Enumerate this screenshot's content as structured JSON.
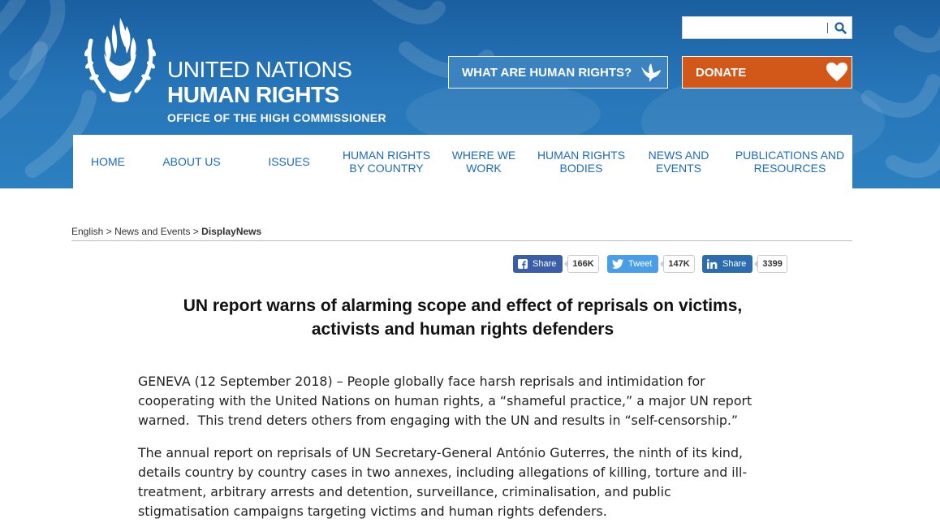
{
  "header": {
    "logo_line1": "UNITED NATIONS",
    "logo_line2": "HUMAN RIGHTS",
    "logo_line3": "OFFICE OF THE HIGH COMMISSIONER",
    "search_placeholder": "",
    "what_button": "WHAT ARE HUMAN RIGHTS?",
    "donate_button": "DONATE",
    "colors": {
      "header_blue": "#2675b8",
      "donate_orange": "#d2581a",
      "nav_text": "#1e6bb8"
    }
  },
  "nav": {
    "items": [
      {
        "label": "HOME"
      },
      {
        "label": "ABOUT US"
      },
      {
        "label": "ISSUES"
      },
      {
        "label": "HUMAN RIGHTS\nBY COUNTRY"
      },
      {
        "label": "WHERE WE\nWORK"
      },
      {
        "label": "HUMAN RIGHTS\nBODIES"
      },
      {
        "label": "NEWS AND\nEVENTS"
      },
      {
        "label": "PUBLICATIONS AND\nRESOURCES"
      }
    ]
  },
  "breadcrumb": {
    "item1": "English",
    "sep": ">",
    "item2": "News and Events",
    "current": "DisplayNews"
  },
  "share": {
    "facebook": {
      "label": "Share",
      "count": "166K"
    },
    "twitter": {
      "label": "Tweet",
      "count": "147K"
    },
    "linkedin": {
      "label": "Share",
      "count": "3399"
    }
  },
  "article": {
    "headline_line1": "UN report warns of alarming scope and effect of reprisals on victims,",
    "headline_line2": "activists and human rights defenders",
    "paragraph1": [
      "GENEVA (12 September 2018) – People globally face harsh reprisals and intimidation for",
      "cooperating with the United Nations on human rights, a “shameful practice,” a major UN report",
      "warned.  This trend deters others from engaging with the UN and results in “self-censorship.”"
    ],
    "paragraph2": [
      "The annual report on reprisals of UN Secretary-General António Guterres, the ninth of its kind,",
      "details country by country cases in two annexes, including allegations of killing, torture and ill-",
      "treatment, arbitrary arrests and detention, surveillance, criminalisation, and public",
      "stigmatisation campaigns targeting victims and human rights defenders."
    ]
  }
}
